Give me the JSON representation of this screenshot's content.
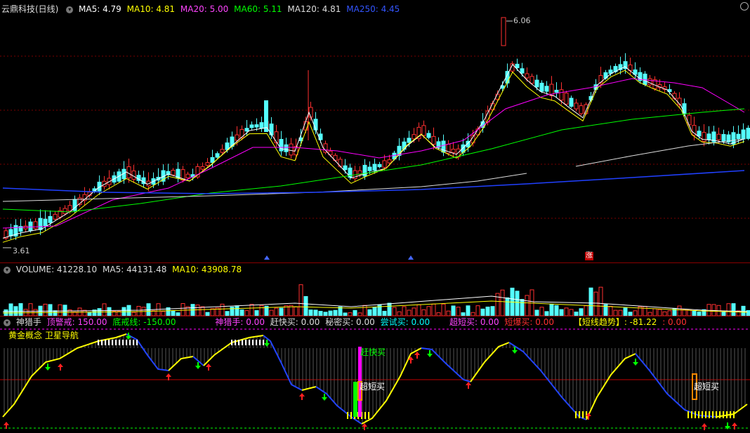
{
  "price_panel": {
    "title": "云鼎科技(日线)",
    "ma5": "MA5: 4.79",
    "ma10": "MA10: 4.81",
    "ma20": "MA20: 5.00",
    "ma60": "MA60: 5.11",
    "ma120": "MA120: 4.81",
    "ma250": "MA250: 4.45",
    "high_label": "6.06",
    "low_label": "3.61",
    "zhang_badge": "涨",
    "colors": {
      "ma5": "#ffffff",
      "ma10": "#ffff00",
      "ma20": "#ff00ff",
      "ma60": "#00ff00",
      "ma120": "#ffffff",
      "ma250": "#0000ff"
    }
  },
  "volume_panel": {
    "title": "VOLUME: 41228.10",
    "ma5": "MA5: 44131.48",
    "ma10": "MA10: 43908.78"
  },
  "indicator_panel": {
    "name": "神猎手",
    "ding": "顶警戒: 150.00",
    "di": "底戒线: -150.00",
    "shen": "神猎手: 0.00",
    "gan": "赶快买: 0.00",
    "mi": "秘密买: 0.00",
    "chang": "尝试买: 0.00",
    "chao": "超短买: 0.00",
    "duan": "短爆买: 0.00",
    "trend": "【短线趋势】: -81.22",
    "trend_extra": ": 0.00",
    "sub": "黄金概念 卫星导航",
    "mark_ganbuy": "赶快买",
    "mark_chaoduan1": "超短买",
    "mark_chaoduan2": "超短买"
  }
}
